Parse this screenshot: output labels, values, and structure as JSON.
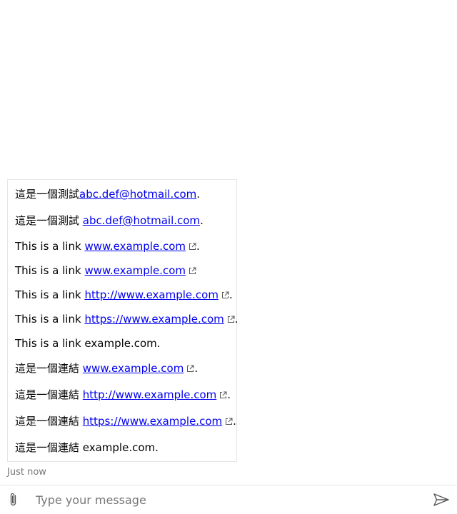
{
  "transcript": {
    "message": {
      "lines": [
        {
          "pre": "這是一個測試",
          "link": "abc.def@hotmail.com",
          "post": ".",
          "external": false
        },
        {
          "pre": "這是一個測試 ",
          "link": "abc.def@hotmail.com",
          "post": ".",
          "external": false
        },
        {
          "pre": "This is a link ",
          "link": "www.example.com",
          "post": ".",
          "external": true
        },
        {
          "pre": "This is a link ",
          "link": "www.example.com",
          "post": "",
          "external": true
        },
        {
          "pre": "This is a link ",
          "link": "http://www.example.com",
          "post": ".",
          "external": true
        },
        {
          "pre": "This is a link ",
          "link": "https://www.example.com",
          "post": ".",
          "external": true
        },
        {
          "pre": "This is a link example.com.",
          "link": "",
          "post": "",
          "external": false
        },
        {
          "pre": "這是一個連結 ",
          "link": "www.example.com",
          "post": ".",
          "external": true
        },
        {
          "pre": "這是一個連結 ",
          "link": "http://www.example.com",
          "post": ".",
          "external": true
        },
        {
          "pre": "這是一個連結 ",
          "link": "https://www.example.com",
          "post": ".",
          "external": true
        },
        {
          "pre": "這是一個連結 example.com.",
          "link": "",
          "post": "",
          "external": false
        }
      ]
    },
    "timestamp": "Just now"
  },
  "sendbox": {
    "placeholder": "Type your message",
    "value": "",
    "attach_icon": "paperclip-icon",
    "send_icon": "send-icon"
  },
  "colors": {
    "link": "#0000ee",
    "border": "#e6e6e6",
    "muted": "#767676"
  }
}
